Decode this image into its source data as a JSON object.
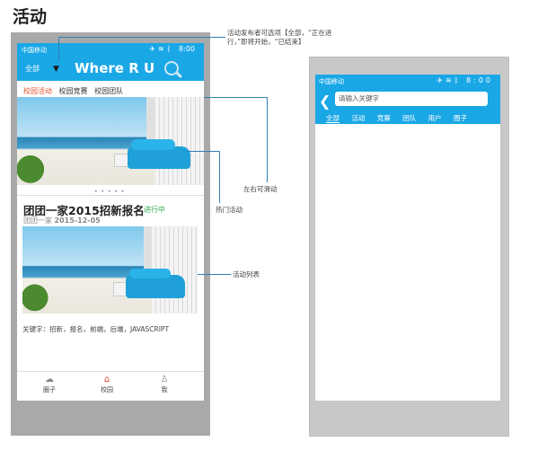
{
  "page": {
    "title": "活动"
  },
  "left_phone": {
    "status": {
      "carrier": "中国移动",
      "time": "8:00",
      "icons": [
        "airplane-icon",
        "wifi-icon",
        "bluetooth-icon"
      ]
    },
    "header": {
      "filter_label": "全部",
      "caret": "▼",
      "brand": "Where R U"
    },
    "tabs": [
      "校园活动",
      "校园竞赛",
      "校园团队"
    ],
    "carousel_dots": "• • • • •",
    "event": {
      "title": "团团一家2015招新报名",
      "status": "进行中",
      "organizer": "团团一家",
      "date": "2015-12-05",
      "keywords": "关键字：招新，报名，前端，后端，JAVASCRIPT"
    },
    "bottom_nav": [
      {
        "label": "圈子",
        "icon": "chat-icon"
      },
      {
        "label": "校园",
        "icon": "school-icon"
      },
      {
        "label": "我",
        "icon": "user-icon"
      }
    ]
  },
  "annotations": {
    "publisher_options": "活动发布者可选项【全部，“正在进行，”即将开始，“已结束】",
    "swipe": "左右可滑动",
    "hot": "热门活动",
    "list": "活动列表"
  },
  "right_phone": {
    "status": {
      "carrier": "中国移动",
      "time": "8:00"
    },
    "search_placeholder": "请输入关键字",
    "tabs": [
      "全部",
      "活动",
      "竞赛",
      "团队",
      "用户",
      "圈子"
    ]
  },
  "colors": {
    "accent": "#1aa7e6",
    "active_tab": "#e2542b",
    "status_green": "#2fa84f"
  }
}
